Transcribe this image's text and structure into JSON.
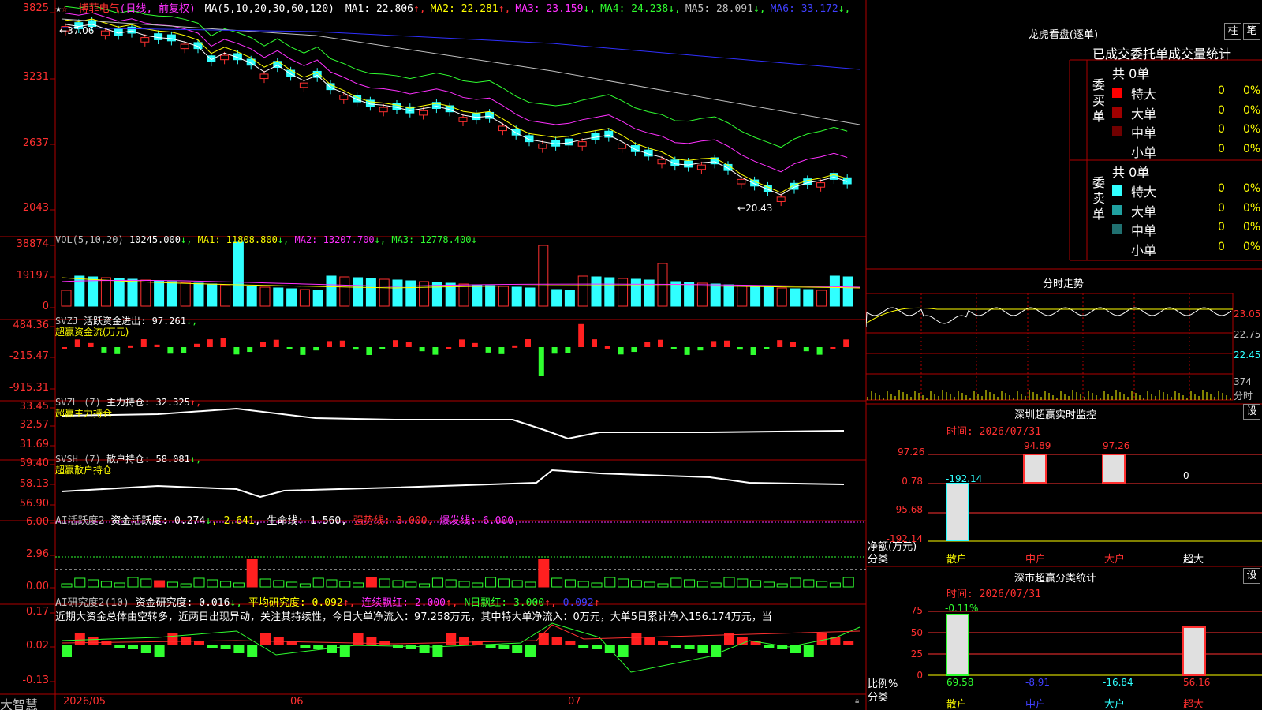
{
  "stock": {
    "name": "博菲电气",
    "period": "(日线, 前复权)",
    "ma_label": "MA(5,10,20,30,60,120)",
    "mas": [
      {
        "label": "MA1: 22.806",
        "arrow": "↑",
        "color": "#ffffff"
      },
      {
        "label": "MA2: 22.281",
        "arrow": "↑",
        "color": "#ffff00"
      },
      {
        "label": "MA3: 23.159",
        "arrow": "↓",
        "color": "#ff30ff"
      },
      {
        "label": "MA4: 24.238",
        "arrow": "↓",
        "color": "#30ff30"
      },
      {
        "label": "MA5: 28.091",
        "arrow": "↓",
        "color": "#c0c0c0"
      },
      {
        "label": "MA6: 33.172",
        "arrow": "↓",
        "color": "#4040ff"
      }
    ],
    "high_note": "37.06",
    "low_note": "20.43",
    "price_ticks": [
      "3825",
      "3231",
      "2637",
      "2043"
    ]
  },
  "vol": {
    "label": "VOL(5,10,20)",
    "value": "10245.000",
    "ma1": "MA1: 11808.800",
    "ma2": "MA2: 13207.700",
    "ma3": "MA3: 12778.400",
    "ticks": [
      "38874",
      "19197",
      "0"
    ]
  },
  "svzj": {
    "label": "SVZJ",
    "title": "活跃资金进出: 97.261",
    "arrow": "↓,",
    "sub": "超赢资金流(万元)",
    "ticks": [
      "484.36",
      "-215.47",
      "-915.31"
    ]
  },
  "svzl": {
    "label": "SVZL (7)",
    "title": "主力持仓: 32.325",
    "arrow": "↑,",
    "sub": "超赢主力持仓",
    "ticks": [
      "33.45",
      "32.57",
      "31.69"
    ]
  },
  "svsh": {
    "label": "SVSH (7)",
    "title": "散户持仓: 58.081",
    "arrow": "↓,",
    "sub": "超赢散户持仓",
    "ticks": [
      "59.40",
      "58.13",
      "56.90"
    ]
  },
  "ai1": {
    "label": "AI活跃度2",
    "v1": "资金活跃度: 0.274",
    "a1": "↓",
    "v2": "2.641",
    "a2": ",",
    "v3": "生命线: 1.560,",
    "v4": "强势线: 3.000,",
    "v5": "爆发线: 6.000,",
    "ticks": [
      "6.00",
      "2.96",
      "0.00"
    ]
  },
  "ai2": {
    "label": "AI研究度2(10)",
    "v1": "资金研究度: 0.016",
    "a1": "↓,",
    "v2": "平均研究度: 0.092",
    "a2": "↑,",
    "v3": "连续飘红: 2.000",
    "a3": "↑,",
    "v4": "N日飘红: 3.000",
    "a4": "↑,",
    "v5": "0.092",
    "a5": "↑",
    "comment": "近期大资金总体由空转多，近两日出现异动，关注其持续性，今日大单净流入：97.258万元，其中特大单净流入：0万元，大单5日累计净入156.174万元，当",
    "ticks": [
      "0.17",
      "0.02",
      "-0.13"
    ]
  },
  "dates": {
    "brand": "大智慧",
    "d1": "2026/05",
    "d2": "06",
    "d3": "07"
  },
  "dragon": {
    "title": "龙虎看盘(逐单)",
    "btn1": "柱",
    "btn2": "笔",
    "subtitle": "已成交委托单成交量统计",
    "buy_label": "委买单",
    "sell_label": "委卖单",
    "buy_total": "共 0单",
    "sell_total": "共 0单",
    "buy_rows": [
      {
        "name": "特大",
        "n": "0",
        "p": "0%",
        "color": "#ff0000"
      },
      {
        "name": "大单",
        "n": "0",
        "p": "0%",
        "color": "#a00000"
      },
      {
        "name": "中单",
        "n": "0",
        "p": "0%",
        "color": "#700000"
      },
      {
        "name": "小单",
        "n": "0",
        "p": "0%",
        "color": "#000000"
      }
    ],
    "sell_rows": [
      {
        "name": "特大",
        "n": "0",
        "p": "0%",
        "color": "#30ffff"
      },
      {
        "name": "大单",
        "n": "0",
        "p": "0%",
        "color": "#20a0a0"
      },
      {
        "name": "中单",
        "n": "0",
        "p": "0%",
        "color": "#207070"
      },
      {
        "name": "小单",
        "n": "0",
        "p": "0%",
        "color": "#000000"
      }
    ]
  },
  "intraday": {
    "title": "分时走势",
    "ticks": [
      "23.05",
      "22.75",
      "22.45"
    ],
    "vol_tick": "374",
    "vol_unit": "分时"
  },
  "monitor": {
    "title": "深圳超赢实时监控",
    "btn": "设",
    "time": "时间: 2026/07/31",
    "ticks": [
      "97.26",
      "0.78",
      "-95.68",
      "-192.14"
    ],
    "bars": [
      {
        "label": "散户",
        "value": "-192.14"
      },
      {
        "label": "中户",
        "value": "94.89"
      },
      {
        "label": "大户",
        "value": "97.26"
      },
      {
        "label": "超大",
        "value": "0"
      }
    ],
    "ylabel": "净额(万元)",
    "xlabel": "分类"
  },
  "classify": {
    "title": "深市超赢分类统计",
    "btn": "设",
    "time": "时间: 2026/07/31",
    "ticks": [
      "75",
      "50",
      "25",
      "0"
    ],
    "top_note": "-0.11%",
    "bars": [
      {
        "label": "散户",
        "value": "69.58"
      },
      {
        "label": "中户",
        "value": "-8.91"
      },
      {
        "label": "大户",
        "value": "-16.84"
      },
      {
        "label": "超大",
        "value": "56.16"
      }
    ],
    "ylabel": "比例%",
    "xlabel": "分类"
  }
}
